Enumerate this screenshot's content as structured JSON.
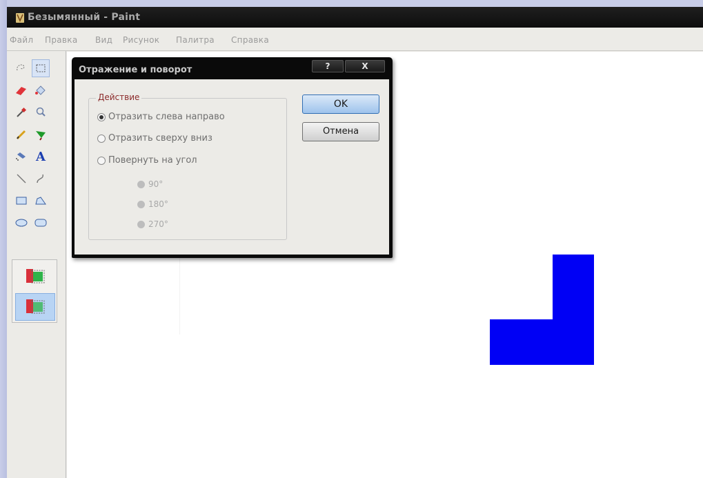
{
  "window": {
    "title": "Безымянный - Paint"
  },
  "menu": {
    "items": [
      "Файл",
      "Правка",
      "Вид",
      "Рисунок",
      "Палитра",
      "Справка"
    ]
  },
  "toolbox": {
    "tools": [
      {
        "icon": "free-select-icon"
      },
      {
        "icon": "rect-select-icon"
      },
      {
        "icon": "eraser-icon"
      },
      {
        "icon": "fill-icon"
      },
      {
        "icon": "color-picker-icon"
      },
      {
        "icon": "magnifier-icon"
      },
      {
        "icon": "pencil-icon"
      },
      {
        "icon": "brush-icon"
      },
      {
        "icon": "airbrush-icon"
      },
      {
        "icon": "text-icon",
        "glyph": "A"
      },
      {
        "icon": "line-icon"
      },
      {
        "icon": "curve-icon"
      },
      {
        "icon": "rectangle-icon"
      },
      {
        "icon": "polygon-icon"
      },
      {
        "icon": "ellipse-icon"
      },
      {
        "icon": "rounded-rect-icon"
      }
    ],
    "options": [
      "opaque-selection-icon",
      "transparent-selection-icon"
    ]
  },
  "canvas": {
    "background": "#ffffff",
    "figure_color": "#0000f5"
  },
  "dialog": {
    "title": "Отражение и поворот",
    "help_label": "?",
    "close_label": "X",
    "group_label": "Действие",
    "options": [
      {
        "label": "Отразить слева направо",
        "checked": true
      },
      {
        "label": "Отразить сверху вниз",
        "checked": false
      },
      {
        "label": "Повернуть на угол",
        "checked": false
      }
    ],
    "angles": [
      "90°",
      "180°",
      "270°"
    ],
    "ok_label": "OK",
    "cancel_label": "Отмена"
  }
}
